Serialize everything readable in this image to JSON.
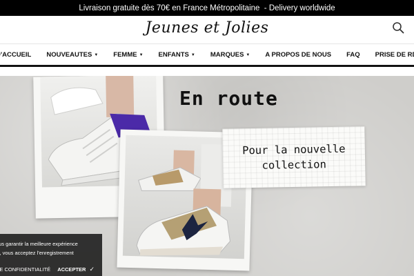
{
  "announcement": "Livraison gratuite dès 70€ en France Métropolitaine  - Delivery worldwide",
  "header": {
    "logo_text": "Jeunes et Jolies",
    "search_icon": "search-icon"
  },
  "nav": {
    "items": [
      {
        "label": "D'ACCUEIL",
        "caret": ""
      },
      {
        "label": "NOUVEAUTES",
        "caret": "▼"
      },
      {
        "label": "FEMME",
        "caret": "▼"
      },
      {
        "label": "ENFANTS",
        "caret": "▼"
      },
      {
        "label": "MARQUES",
        "caret": "▼"
      },
      {
        "label": "A PROPOS DE NOUS",
        "caret": ""
      },
      {
        "label": "FAQ",
        "caret": ""
      },
      {
        "label": "PRISE DE RDV",
        "caret": ""
      }
    ]
  },
  "hero": {
    "headline": "En route",
    "note_line1": "Pour la nouvelle",
    "note_line2": "collection"
  },
  "cookie": {
    "line1": "ous garantir la meilleure expérience",
    "line2": "R, vous acceptez l'enregistrement",
    "policy_label": "DE CONFIDENTIALITÉ",
    "accept_label": "ACCEPTER",
    "accept_icon": "checkmark-icon"
  },
  "colors": {
    "topbar_bg": "#000000",
    "hero_bg": "#cfcecb",
    "cookie_bg": "#1e1e1e",
    "sneaker_accent": "#4b2aa8"
  }
}
